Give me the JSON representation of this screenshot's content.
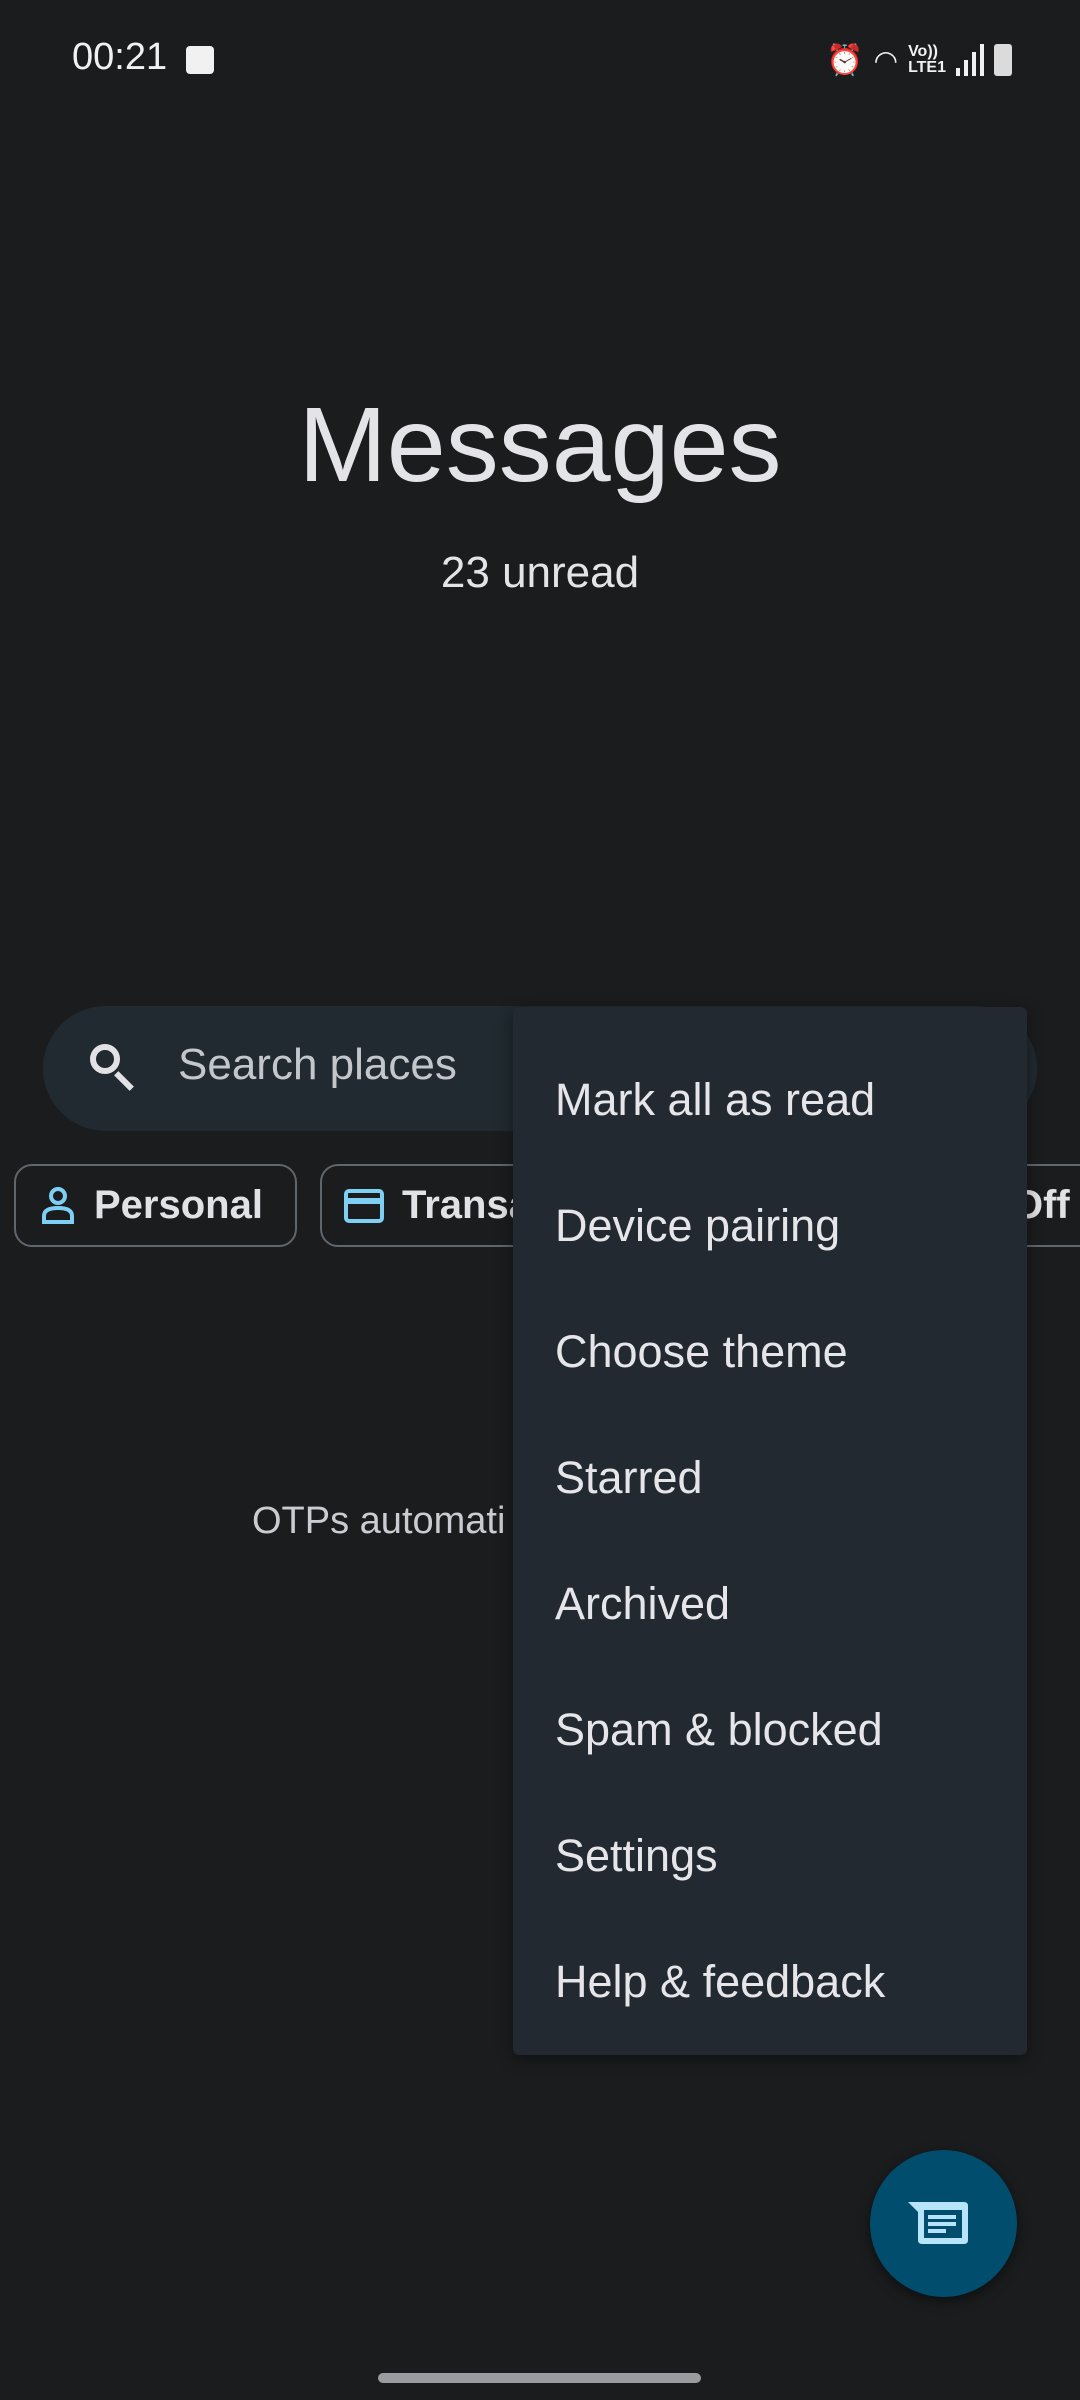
{
  "status_bar": {
    "time": "00:21",
    "network_label_top": "Vo))",
    "network_label_bottom": "LTE1"
  },
  "header": {
    "title": "Messages",
    "unread": "23 unread"
  },
  "search": {
    "placeholder": "Search places"
  },
  "chips": [
    {
      "label": "Personal",
      "icon": "person-icon"
    },
    {
      "label": "Transa",
      "icon": "card-icon"
    },
    {
      "label": "Off",
      "icon": ""
    }
  ],
  "empty_state": {
    "text": "OTPs automati"
  },
  "menu": {
    "items": [
      "Mark all as read",
      "Device pairing",
      "Choose theme",
      "Starred",
      "Archived",
      "Spam & blocked",
      "Settings",
      "Help & feedback"
    ]
  },
  "colors": {
    "background": "#1a1c1e",
    "menu": "#222930",
    "fab": "#004d6e",
    "accent": "#7fcff5"
  }
}
